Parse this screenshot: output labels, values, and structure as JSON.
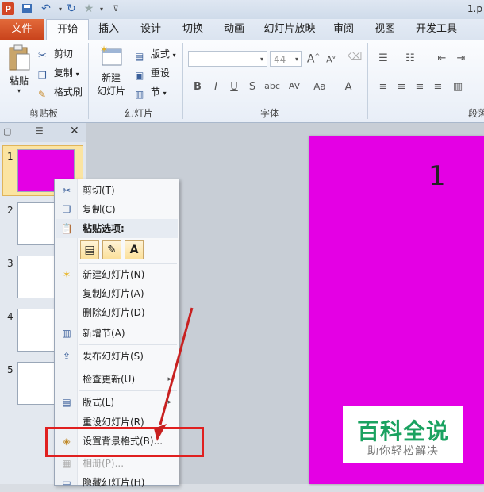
{
  "titlebar": {
    "doc_title": "1.p",
    "app_logo": "P"
  },
  "tabs": [
    "文件",
    "开始",
    "插入",
    "设计",
    "切换",
    "动画",
    "幻灯片放映",
    "审阅",
    "视图",
    "开发工具"
  ],
  "ribbon": {
    "clipboard": {
      "paste": "粘贴",
      "cut": "剪切",
      "copy": "复制",
      "format_painter": "格式刷",
      "label": "剪贴板"
    },
    "slides": {
      "new_slide_line1": "新建",
      "new_slide_line2": "幻灯片",
      "layout": "版式",
      "reset": "重设",
      "section": "节",
      "label": "幻灯片"
    },
    "font": {
      "font_size": "44",
      "label": "字体"
    },
    "paragraph": {
      "label": "段落"
    }
  },
  "thumbnails": [
    "1",
    "2",
    "3",
    "4",
    "5"
  ],
  "slide": {
    "number": "1",
    "background_color": "#e400e4"
  },
  "context_menu": {
    "cut": "剪切(T)",
    "copy": "复制(C)",
    "paste_options": "粘贴选项:",
    "paste_text_option": "A",
    "new_slide": "新建幻灯片(N)",
    "duplicate_slide": "复制幻灯片(A)",
    "delete_slide": "删除幻灯片(D)",
    "add_section": "新增节(A)",
    "publish_slides": "发布幻灯片(S)",
    "check_updates": "检查更新(U)",
    "layout": "版式(L)",
    "reset_slide": "重设幻灯片(R)",
    "format_background": "设置背景格式(B)...",
    "photo_album": "相册(P)...",
    "hide_slide": "隐藏幻灯片(H)"
  },
  "watermark": {
    "title": "百科全说",
    "subtitle": "助你轻松解决"
  },
  "colors": {
    "highlight": "#e02020",
    "arrow": "#c82020",
    "watermark_green": "#1aa260"
  }
}
